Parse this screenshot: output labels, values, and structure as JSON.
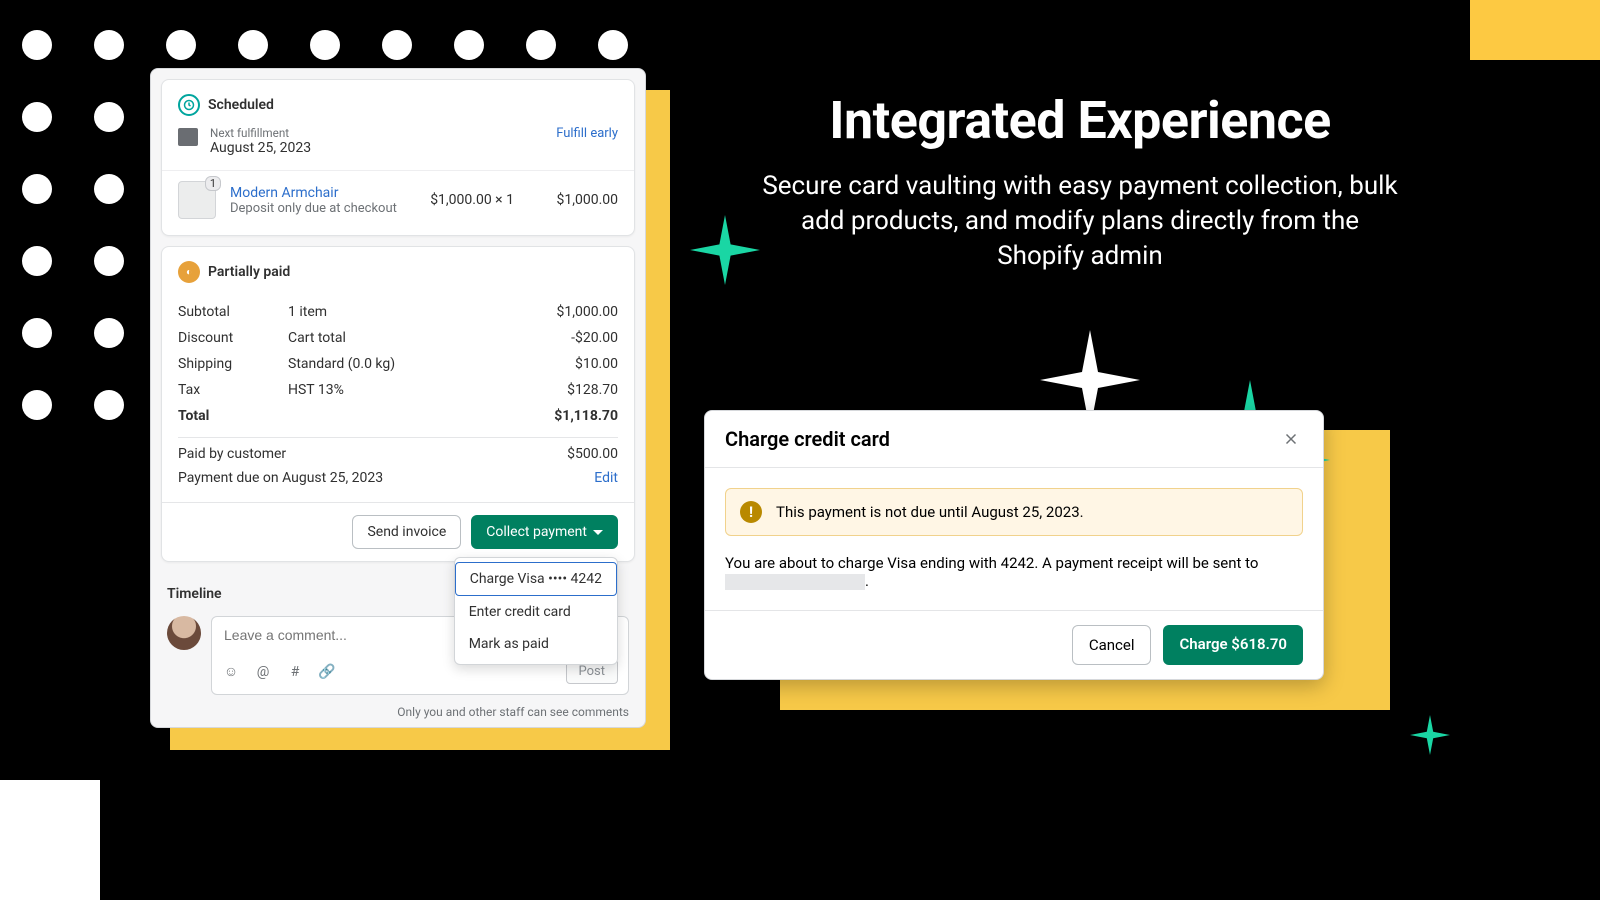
{
  "headline": "Integrated Experience",
  "subheadline": "Secure card vaulting with easy payment collection, bulk add products, and modify plans directly from the Shopify admin",
  "scheduled": {
    "title": "Scheduled",
    "nextLabel": "Next fulfillment",
    "nextDate": "August 25, 2023",
    "fulfillEarly": "Fulfill early",
    "lineItem": {
      "qtyBadge": "1",
      "name": "Modern Armchair",
      "note": "Deposit only due at checkout",
      "unit": "$1,000.00 × 1",
      "total": "$1,000.00"
    }
  },
  "payment": {
    "title": "Partially paid",
    "rows": [
      {
        "label": "Subtotal",
        "desc": "1 item",
        "amount": "$1,000.00"
      },
      {
        "label": "Discount",
        "desc": "Cart total",
        "amount": "-$20.00"
      },
      {
        "label": "Shipping",
        "desc": "Standard (0.0 kg)",
        "amount": "$10.00"
      },
      {
        "label": "Tax",
        "desc": "HST 13%",
        "amount": "$128.70"
      }
    ],
    "totalLabel": "Total",
    "totalAmount": "$1,118.70",
    "paidLabel": "Paid by customer",
    "paidAmount": "$500.00",
    "dueLabel": "Payment due on August 25, 2023",
    "editLink": "Edit",
    "sendInvoice": "Send invoice",
    "collect": "Collect payment",
    "dropdown": {
      "chargeVisa": "Charge Visa •••• 4242",
      "enterCard": "Enter credit card",
      "markPaid": "Mark as paid"
    }
  },
  "timeline": {
    "title": "Timeline",
    "placeholder": "Leave a comment...",
    "post": "Post",
    "note": "Only you and other staff can see comments"
  },
  "dialog": {
    "title": "Charge credit card",
    "bannerText": "This payment is not due until August 25, 2023.",
    "bodyText": "You are about to charge Visa ending with 4242. A payment receipt will be sent to ",
    "bodyTrail": ".",
    "cancel": "Cancel",
    "charge": "Charge $618.70"
  }
}
